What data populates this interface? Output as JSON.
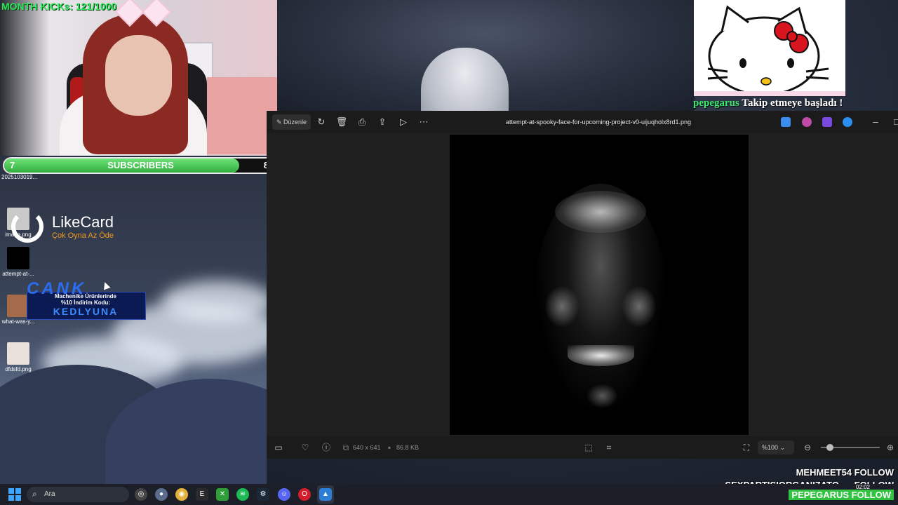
{
  "stream": {
    "month_kicks": "MONTH KICKs: 121/1000",
    "subscribers": {
      "label": "SUBSCRIBERS",
      "current": "7",
      "goal": "8",
      "progress": 0.87
    },
    "subscriber_file": "2025103019..."
  },
  "desktop": {
    "icons": [
      {
        "label": "image.png"
      },
      {
        "label": "attempt-at-..."
      },
      {
        "label": "what-was-y..."
      },
      {
        "label": "dfdsfd.png"
      }
    ]
  },
  "ads": {
    "likecard": {
      "title": "LikeCard",
      "tagline": "Çok Oyna  Az Öde"
    },
    "cank": {
      "logo": "CANK",
      "line1": "Machenike Ürünlerinde",
      "line2": "%10 İndirim Kodu:",
      "code": "KEDLYUNA"
    }
  },
  "alert": {
    "username": "pepegarus",
    "message": "Takip etmeye başladı !"
  },
  "photos_app": {
    "edit_label": "Düzenle",
    "filename": "attempt-at-spooky-face-for-upcoming-project-v0-uijuqholx8rd1.png",
    "toolbar_icons": [
      "rotate-icon",
      "delete-icon",
      "print-icon",
      "share-icon",
      "slideshow-icon",
      "more-icon"
    ],
    "app_icons": [
      "photos-icon",
      "copilot-icon",
      "clipchamp-icon",
      "onedrive-icon"
    ],
    "status": {
      "dimensions": "640 x 641",
      "size": "86.8 KB",
      "zoom": "%100"
    },
    "zoom_level": 0.15
  },
  "follows": [
    {
      "name": "MEHMEET54",
      "action": "FOLLOW"
    },
    {
      "name": "SEXPARTISIORGANIZATO...",
      "action": "FOLLOW"
    },
    {
      "name": "PEPEGARUS",
      "action": "FOLLOW"
    }
  ],
  "taskbar": {
    "search_placeholder": "Ara",
    "apps": [
      "copilot-icon",
      "browser-icon",
      "chrome-icon",
      "epic-icon",
      "xbox-icon",
      "spotify-icon",
      "steam-icon",
      "discord-icon",
      "opera-icon",
      "photos-icon"
    ],
    "clock": "02:02",
    "colors": {
      "accent": "#3ea6ff",
      "kicks": "#2ee65a",
      "follow_highlight": "#32c241"
    }
  }
}
